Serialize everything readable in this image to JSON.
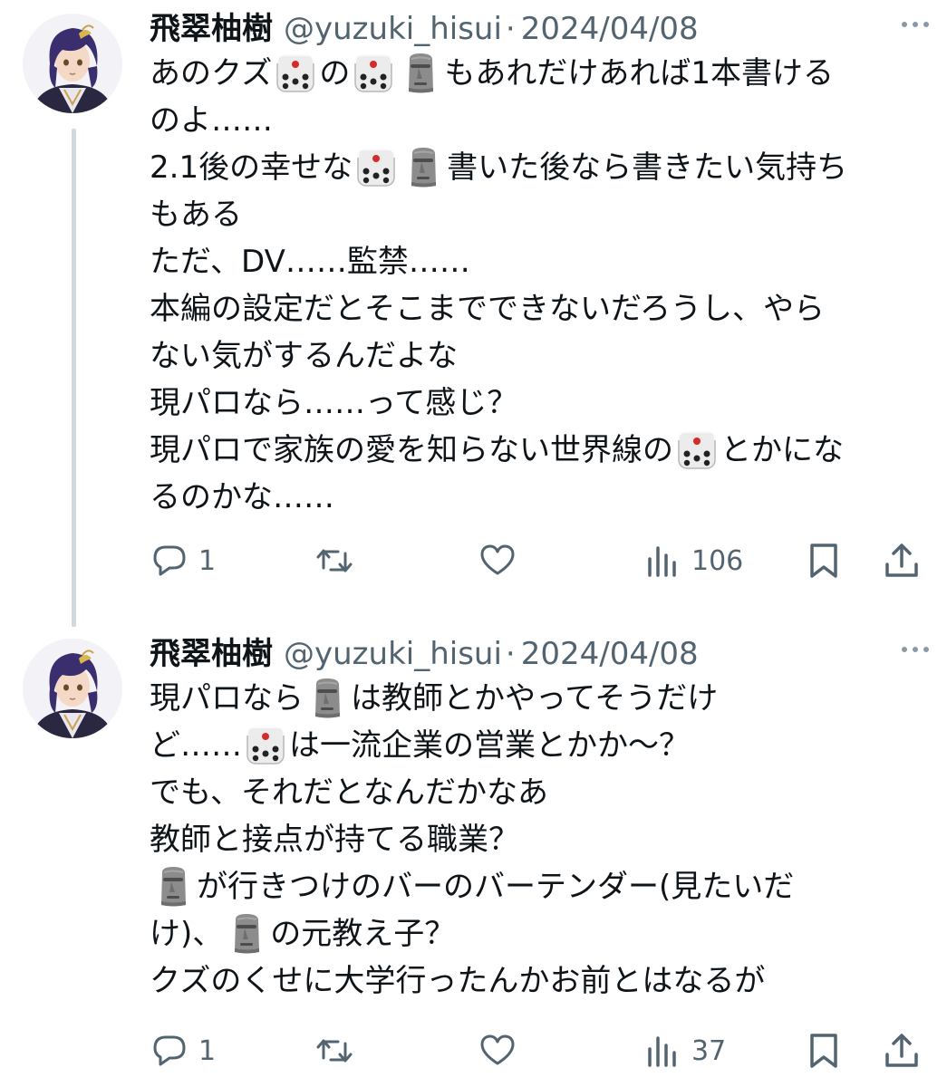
{
  "tweets": [
    {
      "author": {
        "name": "飛翠柚樹",
        "handle": "@yuzuki_hisui",
        "sep": "·",
        "date": "2024/04/08"
      },
      "lines": [
        [
          {
            "t": "あのクズ"
          },
          {
            "e": "dice"
          },
          {
            "t": "の"
          },
          {
            "e": "dice"
          },
          {
            "e": "moai"
          },
          {
            "t": "もあれだけあれば1本書ける"
          }
        ],
        [
          {
            "t": "のよ……"
          }
        ],
        [
          {
            "t": "2.1後の幸せな"
          },
          {
            "e": "dice"
          },
          {
            "e": "moai"
          },
          {
            "t": "書いた後なら書きたい気持ち"
          }
        ],
        [
          {
            "t": "もある"
          }
        ],
        [
          {
            "t": "ただ、DV……監禁……"
          }
        ],
        [
          {
            "t": "本編の設定だとそこまでできないだろうし、やら"
          }
        ],
        [
          {
            "t": "ない気がするんだよな"
          }
        ],
        [
          {
            "t": "現パロなら……って感じ？"
          }
        ],
        [
          {
            "t": "現パロで家族の愛を知らない世界線の"
          },
          {
            "e": "dice"
          },
          {
            "t": "とかにな"
          }
        ],
        [
          {
            "t": "るのかな……"
          }
        ]
      ],
      "actions": {
        "reply_count": "1",
        "retweet_count": "",
        "like_count": "",
        "views_count": "106"
      }
    },
    {
      "author": {
        "name": "飛翠柚樹",
        "handle": "@yuzuki_hisui",
        "sep": "·",
        "date": "2024/04/08"
      },
      "lines": [
        [
          {
            "t": "現パロなら"
          },
          {
            "e": "moai"
          },
          {
            "t": "は教師とかやってそうだけ"
          }
        ],
        [
          {
            "t": "ど……"
          },
          {
            "e": "dice"
          },
          {
            "t": "は一流企業の営業とかか〜？"
          }
        ],
        [
          {
            "t": "でも、それだとなんだかなあ"
          }
        ],
        [
          {
            "t": "教師と接点が持てる職業？"
          }
        ],
        [
          {
            "e": "moai"
          },
          {
            "t": "が行きつけのバーのバーテンダー(見たいだ"
          }
        ],
        [
          {
            "t": "け)、"
          },
          {
            "e": "moai"
          },
          {
            "t": "の元教え子？"
          }
        ],
        [
          {
            "t": "クズのくせに大学行ったんかお前とはなるが"
          }
        ]
      ],
      "actions": {
        "reply_count": "1",
        "retweet_count": "",
        "like_count": "",
        "views_count": "37"
      }
    }
  ],
  "icons": {
    "reply": "speech-bubble-icon",
    "retweet": "retweet-arrows-icon",
    "like": "heart-icon",
    "views": "bar-chart-icon",
    "bookmark": "bookmark-icon",
    "share": "share-upload-icon",
    "emoji_dice": "game-die-emoji",
    "emoji_moai": "moai-emoji"
  },
  "colors": {
    "text": "#0f1419",
    "secondary": "#536471",
    "thread_line": "#cfd9de",
    "background": "#ffffff"
  }
}
